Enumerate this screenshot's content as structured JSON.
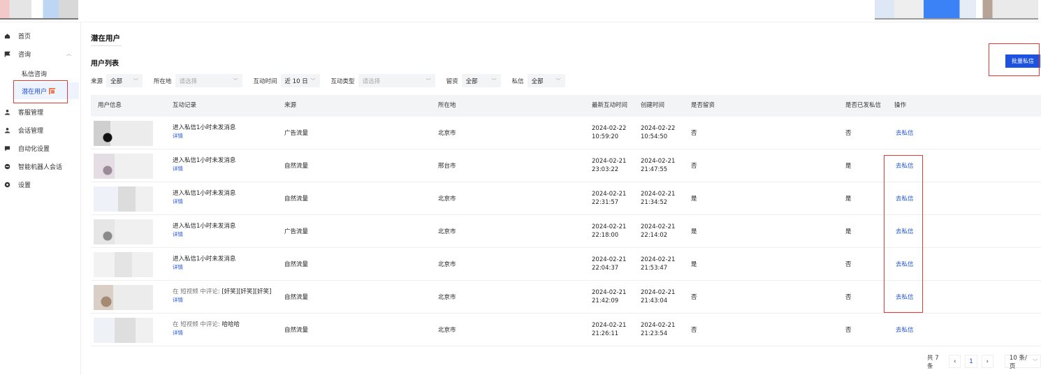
{
  "sidebar": {
    "items": [
      {
        "label": "首页",
        "icon": "home-icon"
      },
      {
        "label": "咨询",
        "icon": "flag-icon"
      },
      {
        "label": "客服管理",
        "icon": "user-icon"
      },
      {
        "label": "会话管理",
        "icon": "user-icon"
      },
      {
        "label": "自动化设置",
        "icon": "chat-icon"
      },
      {
        "label": "智能机器人会话",
        "icon": "robot-icon"
      },
      {
        "label": "设置",
        "icon": "gear-icon"
      }
    ],
    "sub_items": [
      {
        "label": "私信咨询"
      },
      {
        "label": "潜在用户"
      }
    ]
  },
  "page": {
    "title": "潜在用户",
    "section_title": "用户列表",
    "batch_button": "批量私信"
  },
  "filters": [
    {
      "label": "来源",
      "value": "全部",
      "placeholder": false
    },
    {
      "label": "所在地",
      "value": "请选择",
      "placeholder": true
    },
    {
      "label": "互动时间",
      "value": "近 10 日",
      "placeholder": false
    },
    {
      "label": "互动类型",
      "value": "请选择",
      "placeholder": true
    },
    {
      "label": "留资",
      "value": "全部",
      "placeholder": false
    },
    {
      "label": "私信",
      "value": "全部",
      "placeholder": false
    }
  ],
  "table": {
    "columns": [
      "用户信息",
      "互动记录",
      "来源",
      "所在地",
      "最新互动时间",
      "创建时间",
      "是否留资",
      "是否已发私信",
      "操作"
    ],
    "detail_label": "详情",
    "rows": [
      {
        "record_prefix": "",
        "record": "进入私信1小时未发消息",
        "source": "广告流量",
        "location": "北京市",
        "latest_date": "2024-02-22",
        "latest_time": "10:59:20",
        "created_date": "2024-02-22",
        "created_time": "10:54:50",
        "left_info": "否",
        "sent_dm": "否",
        "action": "去私信"
      },
      {
        "record_prefix": "",
        "record": "进入私信1小时未发消息",
        "source": "自然流量",
        "location": "邢台市",
        "latest_date": "2024-02-21",
        "latest_time": "23:03:22",
        "created_date": "2024-02-21",
        "created_time": "21:47:55",
        "left_info": "否",
        "sent_dm": "是",
        "action": "去私信"
      },
      {
        "record_prefix": "",
        "record": "进入私信1小时未发消息",
        "source": "自然流量",
        "location": "北京市",
        "latest_date": "2024-02-21",
        "latest_time": "22:31:57",
        "created_date": "2024-02-21",
        "created_time": "21:34:52",
        "left_info": "是",
        "sent_dm": "是",
        "action": "去私信"
      },
      {
        "record_prefix": "",
        "record": "进入私信1小时未发消息",
        "source": "广告流量",
        "location": "北京市",
        "latest_date": "2024-02-21",
        "latest_time": "22:18:00",
        "created_date": "2024-02-21",
        "created_time": "22:14:02",
        "left_info": "是",
        "sent_dm": "是",
        "action": "去私信"
      },
      {
        "record_prefix": "",
        "record": "进入私信1小时未发消息",
        "source": "自然流量",
        "location": "北京市",
        "latest_date": "2024-02-21",
        "latest_time": "22:04:37",
        "created_date": "2024-02-21",
        "created_time": "21:53:47",
        "left_info": "是",
        "sent_dm": "否",
        "action": "去私信"
      },
      {
        "record_prefix": "在 短视频 中评论: ",
        "record": "[奸笑][奸笑][奸笑]",
        "source": "自然流量",
        "location": "北京市",
        "latest_date": "2024-02-21",
        "latest_time": "21:42:09",
        "created_date": "2024-02-21",
        "created_time": "21:43:04",
        "left_info": "否",
        "sent_dm": "否",
        "action": "去私信"
      },
      {
        "record_prefix": "在 短视频 中评论: ",
        "record": "哈哈哈",
        "source": "自然流量",
        "location": "北京市",
        "latest_date": "2024-02-21",
        "latest_time": "21:26:11",
        "created_date": "2024-02-21",
        "created_time": "21:23:54",
        "left_info": "否",
        "sent_dm": "否",
        "action": "去私信"
      }
    ]
  },
  "pagination": {
    "total": "共 7 条",
    "current": "1",
    "page_size": "10 条/页"
  },
  "colors": {
    "accent": "#1d52e0",
    "highlight_box": "#e53935"
  }
}
